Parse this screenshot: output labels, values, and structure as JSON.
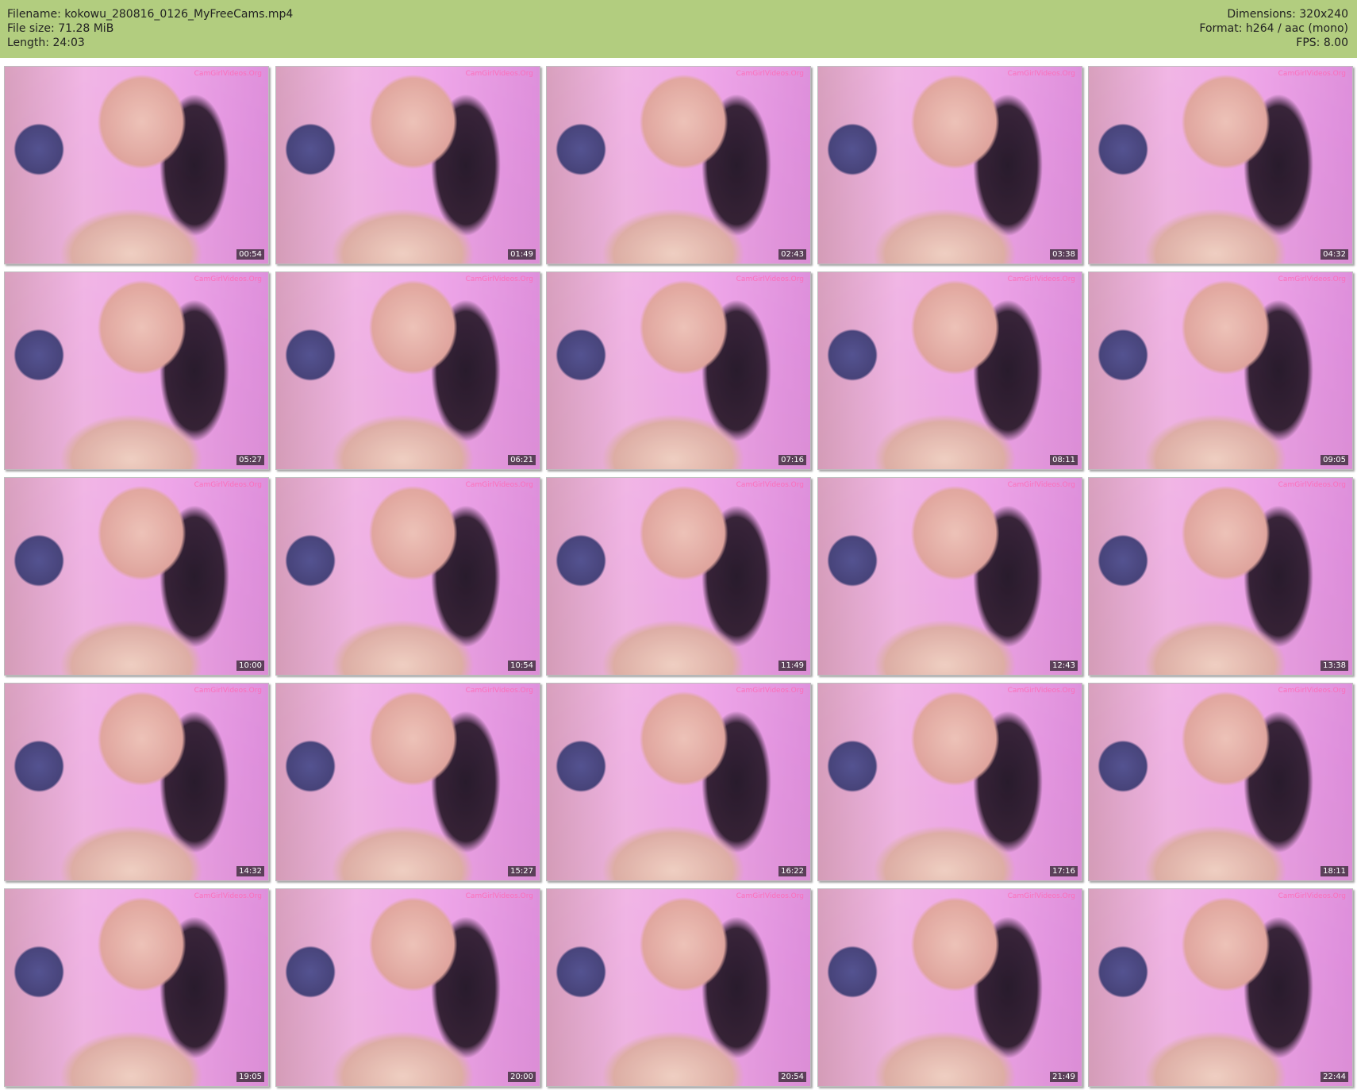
{
  "header": {
    "filename_line": "Filename: kokowu_280816_0126_MyFreeCams.mp4",
    "filesize_line": "File size: 71.28 MiB",
    "length_line": "Length: 24:03",
    "dimensions_line": "Dimensions: 320x240",
    "format_line": "Format: h264 / aac (mono)",
    "fps_line": "FPS: 8.00"
  },
  "watermark": "CamGirlVideos.Org",
  "thumbnails": [
    {
      "timestamp": "00:54"
    },
    {
      "timestamp": "01:49"
    },
    {
      "timestamp": "02:43"
    },
    {
      "timestamp": "03:38"
    },
    {
      "timestamp": "04:32"
    },
    {
      "timestamp": "05:27"
    },
    {
      "timestamp": "06:21"
    },
    {
      "timestamp": "07:16"
    },
    {
      "timestamp": "08:11"
    },
    {
      "timestamp": "09:05"
    },
    {
      "timestamp": "10:00"
    },
    {
      "timestamp": "10:54"
    },
    {
      "timestamp": "11:49"
    },
    {
      "timestamp": "12:43"
    },
    {
      "timestamp": "13:38"
    },
    {
      "timestamp": "14:32"
    },
    {
      "timestamp": "15:27"
    },
    {
      "timestamp": "16:22"
    },
    {
      "timestamp": "17:16"
    },
    {
      "timestamp": "18:11"
    },
    {
      "timestamp": "19:05"
    },
    {
      "timestamp": "20:00"
    },
    {
      "timestamp": "20:54"
    },
    {
      "timestamp": "21:49"
    },
    {
      "timestamp": "22:44"
    }
  ],
  "colors": {
    "header_bg": "#b2cd7f",
    "timestamp_bg": "#2a2a2a",
    "timestamp_text": "#ffffff"
  }
}
